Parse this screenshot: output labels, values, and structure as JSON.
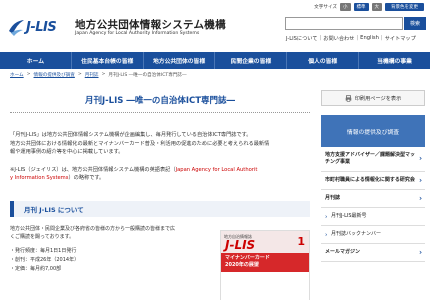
{
  "header": {
    "logo_text": "J-LIS",
    "org_name": "地方公共団体情報システム機構",
    "org_name_en": "Japan Agency for Local Authority Information Systems",
    "text_size_label": "文字サイズ",
    "text_size_small": "小",
    "text_size_medium": "標準",
    "text_size_large": "大",
    "bg_color_label": "背景色を変更",
    "search_button": "検索",
    "util_links": [
      "J-LISについて",
      "お問い合わせ",
      "English",
      "サイトマップ"
    ],
    "brand_color": "#1a4f9c"
  },
  "nav": {
    "items": [
      "ホーム",
      "住民基本台帳の皆様",
      "地方公共団体の皆様",
      "民間企業の皆様",
      "個人の皆様",
      "当機構の事業"
    ]
  },
  "breadcrumb": {
    "items": [
      "ホーム",
      "情報の提供及び調査",
      "月刊誌"
    ],
    "current": "月刊J-LIS ―唯一の自治体ICT専門誌―"
  },
  "main": {
    "title": "月刊J-LIS ―唯一の自治体ICT専門誌―",
    "lead_1": "「月刊J-LIS」は地方公共団体情報システム機構が企画編集し、毎月発行している自治体ICT専門誌です。",
    "lead_2": "地方公共団体における情報化の最新とマイナンバーカード普及・利活用の促進のために必要と考えられる最新情",
    "lead_3": "報や運用事例の紹介等を中心に掲載しています。",
    "note_1": "※J-LIS（ジェイリス）は、地方公共団体情報システム機構の英語表記（",
    "note_hl": "Japan Agency for Local Authorit",
    "note_2": "y Information Systems",
    "note_3": "）の略称です。",
    "section_title": "月刊 J-LIS について",
    "desc_1": "地方公共団体・民間企業及び各府省の皆様の方から一般購読の皆様まで広",
    "desc_2": "くご購読を賜っております。",
    "bullets": [
      "・発行頻度：毎月1日1日発行",
      "・創刊：平成26年（2014年）",
      "・定価：毎月約7,00部"
    ]
  },
  "cover": {
    "label": "地方自治情報誌",
    "logo": "J-LIS",
    "number": "1",
    "band_1": "マイナンバーカード",
    "band_2": "2020年の展望"
  },
  "sidebar": {
    "print_label": "印刷用ページを表示",
    "head": "情報の提供及び調査",
    "items": [
      {
        "label": "地方支援アドバイザー／課題解決型マッチング事業",
        "sub": false
      },
      {
        "label": "市町村職員による情報化に関する研究会",
        "sub": false
      },
      {
        "label": "月刊誌",
        "sub": false
      },
      {
        "label": "月刊J-LIS最新号",
        "sub": true
      },
      {
        "label": "月刊誌バックナンバー",
        "sub": true
      },
      {
        "label": "メールマガジン",
        "sub": false
      }
    ]
  }
}
